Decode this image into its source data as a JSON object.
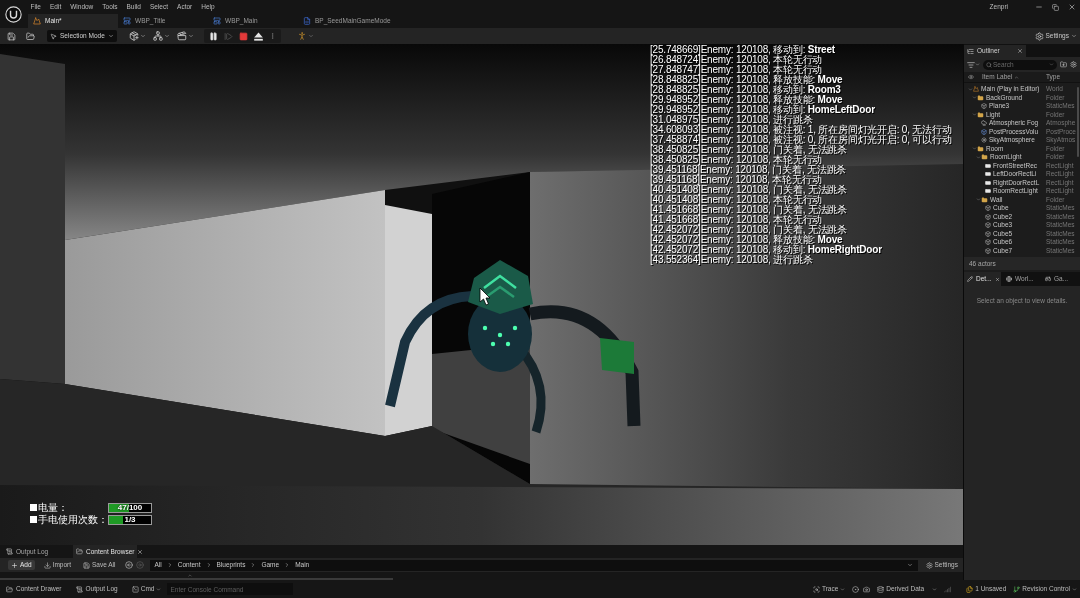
{
  "window": {
    "menu": [
      "File",
      "Edit",
      "Window",
      "Tools",
      "Build",
      "Select",
      "Actor",
      "Help"
    ],
    "user": "Zenpri"
  },
  "document_tabs": [
    {
      "label": "Main*",
      "kind": "level",
      "selected": true
    },
    {
      "label": "WBP_Title",
      "kind": "widget",
      "selected": false
    },
    {
      "label": "WBP_Main",
      "kind": "widget",
      "selected": false
    },
    {
      "label": "BP_SeedMainGameMode",
      "kind": "blueprint",
      "selected": false
    }
  ],
  "toolbar": {
    "mode": "Selection Mode",
    "play_controls": [
      {
        "kind": "pause",
        "disabled": false
      },
      {
        "kind": "step",
        "disabled": true
      },
      {
        "kind": "stop",
        "disabled": false
      },
      {
        "kind": "eject",
        "disabled": false
      }
    ],
    "settings": "Settings"
  },
  "viewport": {
    "log_lines": [
      "[25.748669]Enemy: 120108, 移动到: **Street**",
      "[26.848724]Enemy: 120108, 本轮无行动",
      "[27.848747]Enemy: 120108, 本轮无行动",
      "[28.848825]Enemy: 120108, 释放技能: **Move**",
      "[28.848825]Enemy: 120108, 移动到: **Room3**",
      "[29.948952]Enemy: 120108, 释放技能: **Move**",
      "[29.948952]Enemy: 120108, 移动到: **HomeLeftDoor**",
      "[31.048975]Enemy: 120108, 进行跳杀",
      "[34.608093]Enemy: 120108, 被注视: 1, 所在房间灯光开启: 0, 无法行动",
      "[37.458874]Enemy: 120108, 被注视: 0, 所在房间灯光开启: 0, 可以行动",
      "[38.450825]Enemy: 120108, 门关着, 无法跳杀",
      "[38.450825]Enemy: 120108, 本轮无行动",
      "[39.451168]Enemy: 120108, 门关着, 无法跳杀",
      "[39.451168]Enemy: 120108, 本轮无行动",
      "[40.451408]Enemy: 120108, 门关着, 无法跳杀",
      "[40.451408]Enemy: 120108, 本轮无行动",
      "[41.451668]Enemy: 120108, 门关着, 无法跳杀",
      "[41.451668]Enemy: 120108, 本轮无行动",
      "[42.452072]Enemy: 120108, 门关着, 无法跳杀",
      "[42.452072]Enemy: 120108, 释放技能: **Move**",
      "[42.452072]Enemy: 120108, 移动到: **HomeRightDoor**",
      "[43.552364]Enemy: 120108, 进行跳杀"
    ],
    "hud": [
      {
        "label": "电量：",
        "value": "47/100",
        "level": 0.47
      },
      {
        "label": "手电使用次数：",
        "value": "1/3",
        "level": 0.33
      }
    ]
  },
  "outliner": {
    "tab": "Outliner",
    "search": {
      "placeholder": "Search"
    },
    "columns": [
      "Item Label",
      "Type"
    ],
    "tree": [
      {
        "label": "Main (Play in Editor)",
        "type": "World",
        "kind": "world",
        "expanded": true,
        "children": [
          {
            "label": "BackGround",
            "type": "Folder",
            "kind": "folder",
            "expanded": true,
            "children": [
              {
                "label": "Plane3",
                "type": "StaticMes",
                "kind": "mesh"
              }
            ]
          },
          {
            "label": "Light",
            "type": "Folder",
            "kind": "folder",
            "expanded": true,
            "children": [
              {
                "label": "Atmospheric Fog",
                "type": "Atmosphe",
                "kind": "fog"
              },
              {
                "label": "PostProcessVolu",
                "type": "PostProce",
                "kind": "volume"
              },
              {
                "label": "SkyAtmosphere",
                "type": "SkyAtmos",
                "kind": "sky"
              }
            ]
          },
          {
            "label": "Room",
            "type": "Folder",
            "kind": "folder",
            "expanded": true,
            "children": [
              {
                "label": "RoomLight",
                "type": "Folder",
                "kind": "folder",
                "expanded": true,
                "children": [
                  {
                    "label": "FrontStreetRec",
                    "type": "RectLight",
                    "kind": "light"
                  },
                  {
                    "label": "LeftDoorRectLi",
                    "type": "RectLight",
                    "kind": "light"
                  },
                  {
                    "label": "RightDoorRectL",
                    "type": "RectLight",
                    "kind": "light"
                  },
                  {
                    "label": "RoomRectLight",
                    "type": "RectLight",
                    "kind": "light"
                  }
                ]
              },
              {
                "label": "Wall",
                "type": "Folder",
                "kind": "folder",
                "expanded": true,
                "children": [
                  {
                    "label": "Cube",
                    "type": "StaticMes",
                    "kind": "mesh"
                  },
                  {
                    "label": "Cube2",
                    "type": "StaticMes",
                    "kind": "mesh"
                  },
                  {
                    "label": "Cube3",
                    "type": "StaticMes",
                    "kind": "mesh"
                  },
                  {
                    "label": "Cube5",
                    "type": "StaticMes",
                    "kind": "mesh"
                  },
                  {
                    "label": "Cube6",
                    "type": "StaticMes",
                    "kind": "mesh"
                  },
                  {
                    "label": "Cube7",
                    "type": "StaticMes",
                    "kind": "mesh"
                  }
                ]
              }
            ]
          }
        ]
      }
    ],
    "count": "46 actors"
  },
  "details": {
    "tabs": [
      {
        "label": "Det...",
        "kind": "details",
        "selected": true
      },
      {
        "label": "Worl...",
        "kind": "world",
        "selected": false
      },
      {
        "label": "Ga...",
        "kind": "game",
        "selected": false
      }
    ],
    "hint": "Select an object to view details."
  },
  "content_browser": {
    "tabs": [
      {
        "label": "Output Log",
        "kind": "log",
        "selected": false
      },
      {
        "label": "Content Browser",
        "kind": "content",
        "selected": true
      }
    ],
    "actions": [
      {
        "label": "Add",
        "kind": "add"
      },
      {
        "label": "Import",
        "kind": "import"
      },
      {
        "label": "Save All",
        "kind": "save"
      }
    ],
    "path": [
      "All",
      "Content",
      "Blueprints",
      "Game",
      "Main"
    ],
    "settings": "Settings"
  },
  "status_bar": {
    "left": [
      {
        "label": "Content Drawer",
        "kind": "drawer"
      },
      {
        "label": "Output Log",
        "kind": "log"
      }
    ],
    "cmd": "Cmd",
    "console": {
      "placeholder": "Enter Console Command"
    },
    "trace": "Trace",
    "derived_data": "Derived Data",
    "unsaved": "1 Unsaved",
    "revision_control": "Revision Control"
  }
}
